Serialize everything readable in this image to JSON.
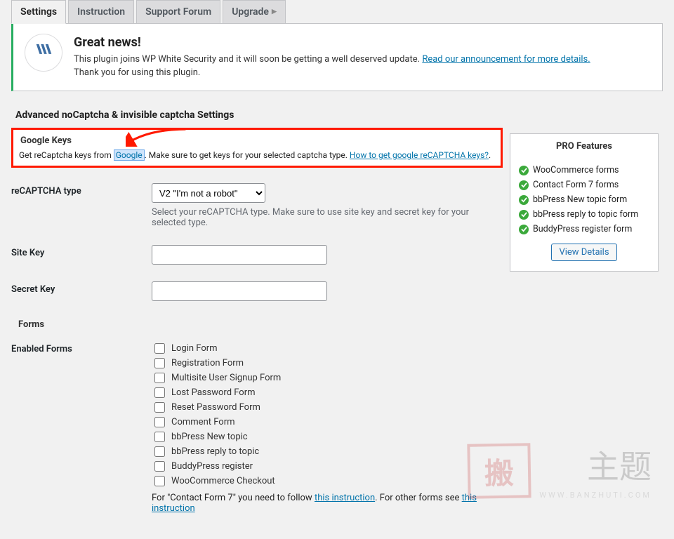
{
  "tabs": [
    "Settings",
    "Instruction",
    "Support Forum",
    "Upgrade"
  ],
  "banner": {
    "heading": "Great news!",
    "line1_before": "This plugin joins WP White Security and it will soon be getting a well deserved update. ",
    "line1_link": "Read our announcement for more details.",
    "line2": "Thank you for using this plugin."
  },
  "section_title": "Advanced noCaptcha & invisible captcha Settings",
  "google_keys": {
    "heading": "Google Keys",
    "text_before": "Get reCaptcha keys from ",
    "google_word": "Google",
    "text_mid": ". Make sure to get keys for your selected captcha type. ",
    "help_link": "How to get google reCAPTCHA keys?",
    "text_after": "."
  },
  "recaptcha_type": {
    "label": "reCAPTCHA type",
    "selected": "V2 \"I'm not a robot\"",
    "desc": "Select your reCAPTCHA type. Make sure to use site key and secret key for your selected type."
  },
  "site_key_label": "Site Key",
  "secret_key_label": "Secret Key",
  "forms_heading": "Forms",
  "enabled_forms": {
    "label": "Enabled Forms",
    "items": [
      "Login Form",
      "Registration Form",
      "Multisite User Signup Form",
      "Lost Password Form",
      "Reset Password Form",
      "Comment Form",
      "bbPress New topic",
      "bbPress reply to topic",
      "BuddyPress register",
      "WooCommerce Checkout"
    ],
    "note_before": "For \"Contact Form 7\" you need to follow ",
    "note_link1": "this instruction",
    "note_mid": ". For other forms see ",
    "note_link2": "this instruction"
  },
  "pro": {
    "heading": "PRO Features",
    "items": [
      "WooCommerce forms",
      "Contact Form 7 forms",
      "bbPress New topic form",
      "bbPress reply to topic form",
      "BuddyPress register form"
    ],
    "button": "View Details"
  },
  "wm": {
    "stamp": "搬",
    "zh": "主题",
    "sub": "WWW.BANZHUTI.COM"
  }
}
